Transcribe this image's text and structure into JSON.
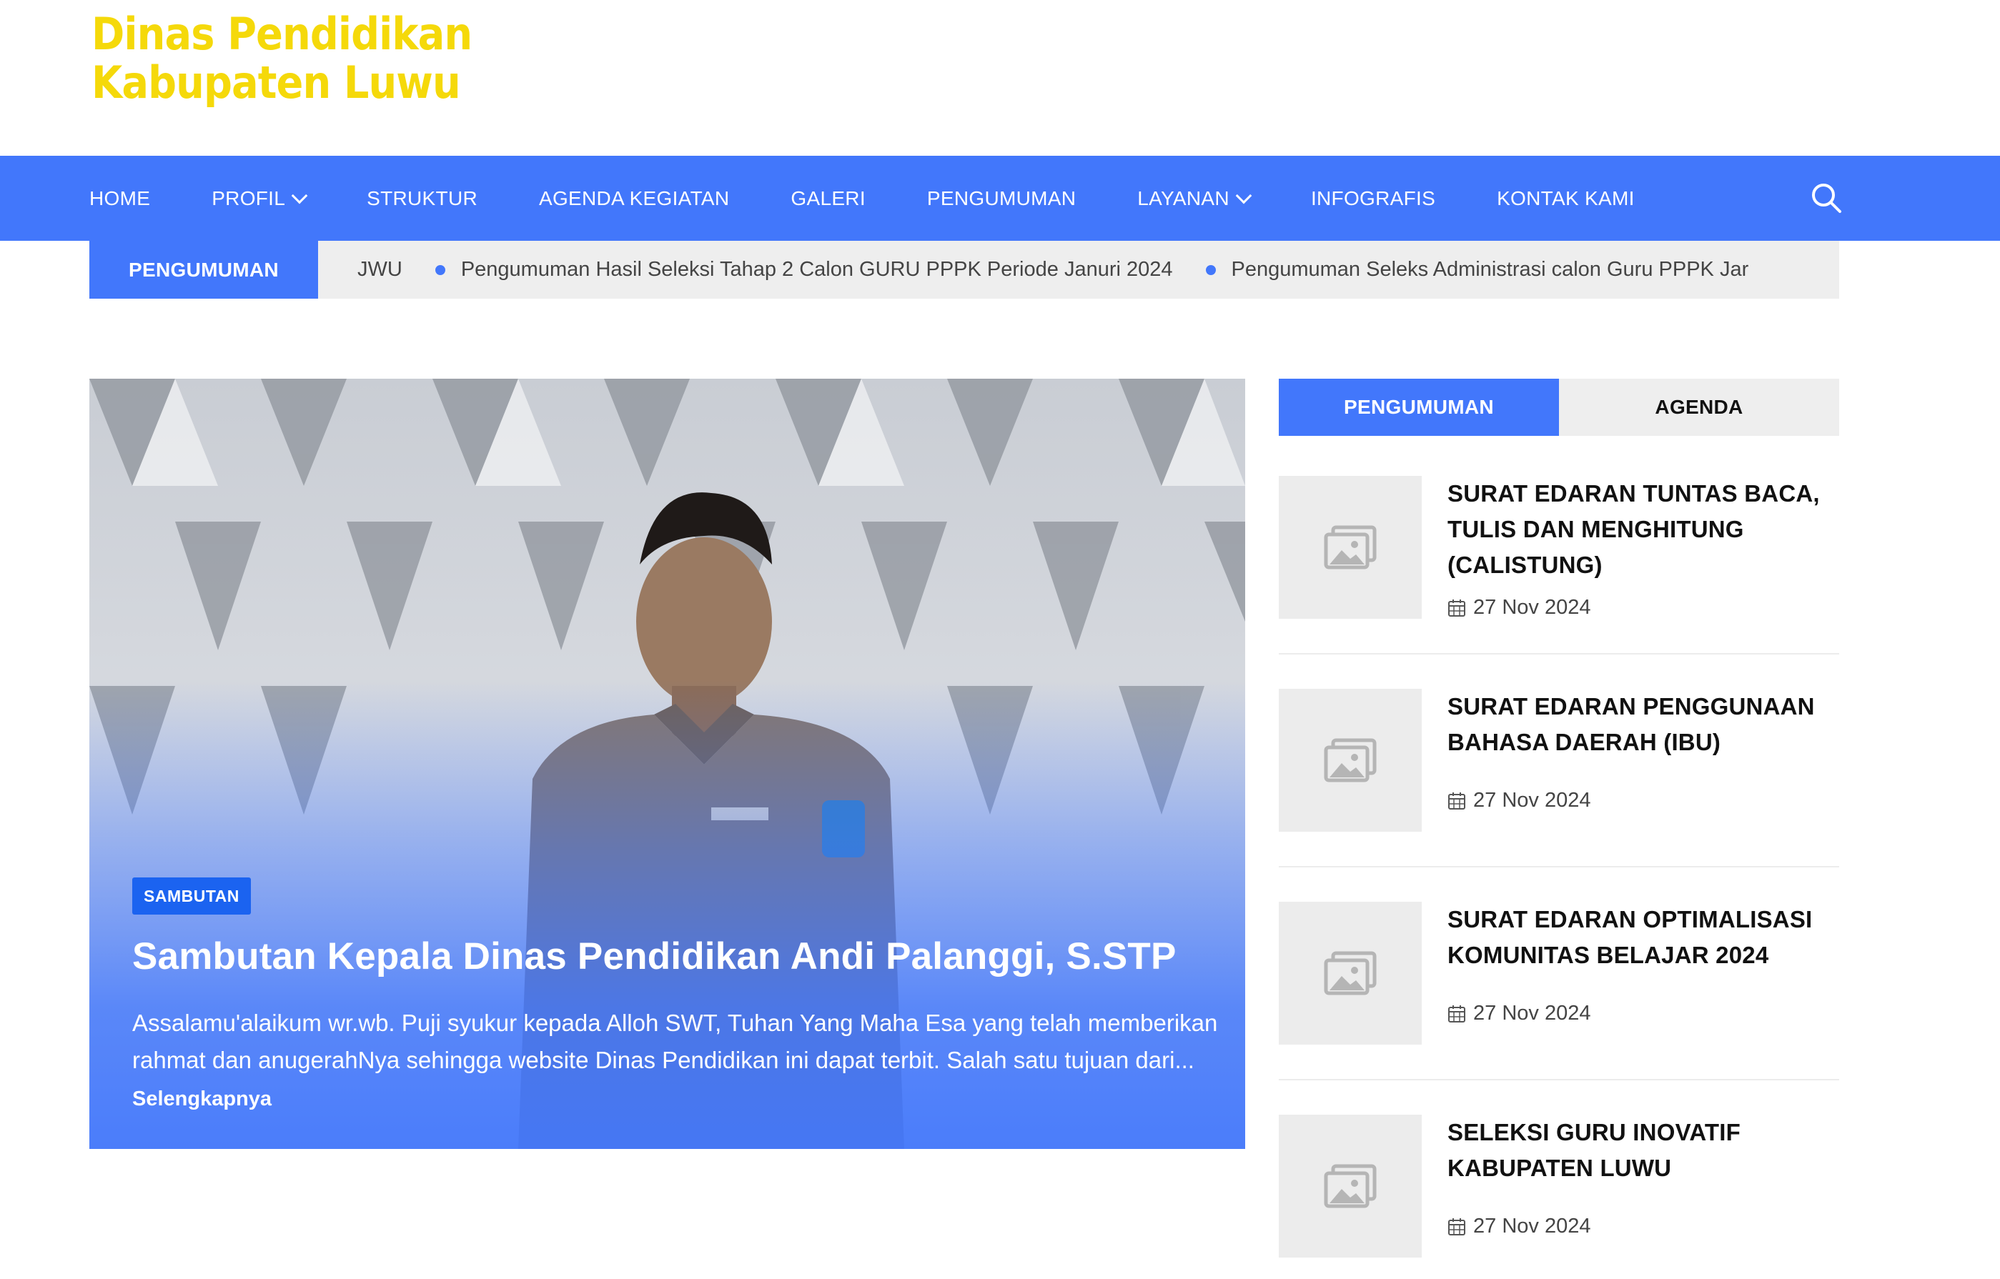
{
  "site": {
    "logo_line1": "Dinas Pendidikan",
    "logo_line2": "Kabupaten Luwu"
  },
  "nav": {
    "items": [
      {
        "label": "HOME"
      },
      {
        "label": "PROFIL"
      },
      {
        "label": "STRUKTUR"
      },
      {
        "label": "AGENDA KEGIATAN"
      },
      {
        "label": "GALERI"
      },
      {
        "label": "PENGUMUMAN"
      },
      {
        "label": "LAYANAN"
      },
      {
        "label": "INFOGRAFIS"
      },
      {
        "label": "KONTAK KAMI"
      }
    ],
    "search_icon": "search-icon"
  },
  "ticker": {
    "label": "PENGUMUMAN",
    "lead": "JWU",
    "items": [
      "Pengumuman Hasil Seleksi Tahap 2 Calon GURU PPPK Periode Januri 2024",
      "Pengumuman Seleks Administrasi calon Guru PPPK Jar"
    ]
  },
  "hero": {
    "category": "SAMBUTAN",
    "title": "Sambutan Kepala Dinas Pendidikan Andi Palanggi, S.STP",
    "excerpt": "Assalamu'alaikum wr.wb. Puji syukur kepada Alloh SWT, Tuhan Yang Maha Esa yang telah memberikan rahmat dan anugerahNya sehingga website Dinas Pendidikan ini dapat terbit. Salah satu tujuan dari...",
    "more": "Selengkapnya"
  },
  "sidebar": {
    "tabs": [
      "PENGUMUMAN",
      "AGENDA"
    ],
    "posts": [
      {
        "title": "SURAT EDARAN TUNTAS BACA, TULIS DAN MENGHITUNG (CALISTUNG)",
        "date": "27 Nov 2024"
      },
      {
        "title": "SURAT EDARAN PENGGUNAAN BAHASA DAERAH (IBU)",
        "date": "27 Nov 2024"
      },
      {
        "title": "SURAT EDARAN OPTIMALISASI KOMUNITAS BELAJAR 2024",
        "date": "27 Nov 2024"
      },
      {
        "title": "SELEKSI GURU INOVATIF KABUPATEN LUWU",
        "date": "27 Nov 2024"
      }
    ]
  },
  "colors": {
    "accent": "#4277fb",
    "badge": "#1b63f0",
    "logo": "#f5d90a"
  }
}
